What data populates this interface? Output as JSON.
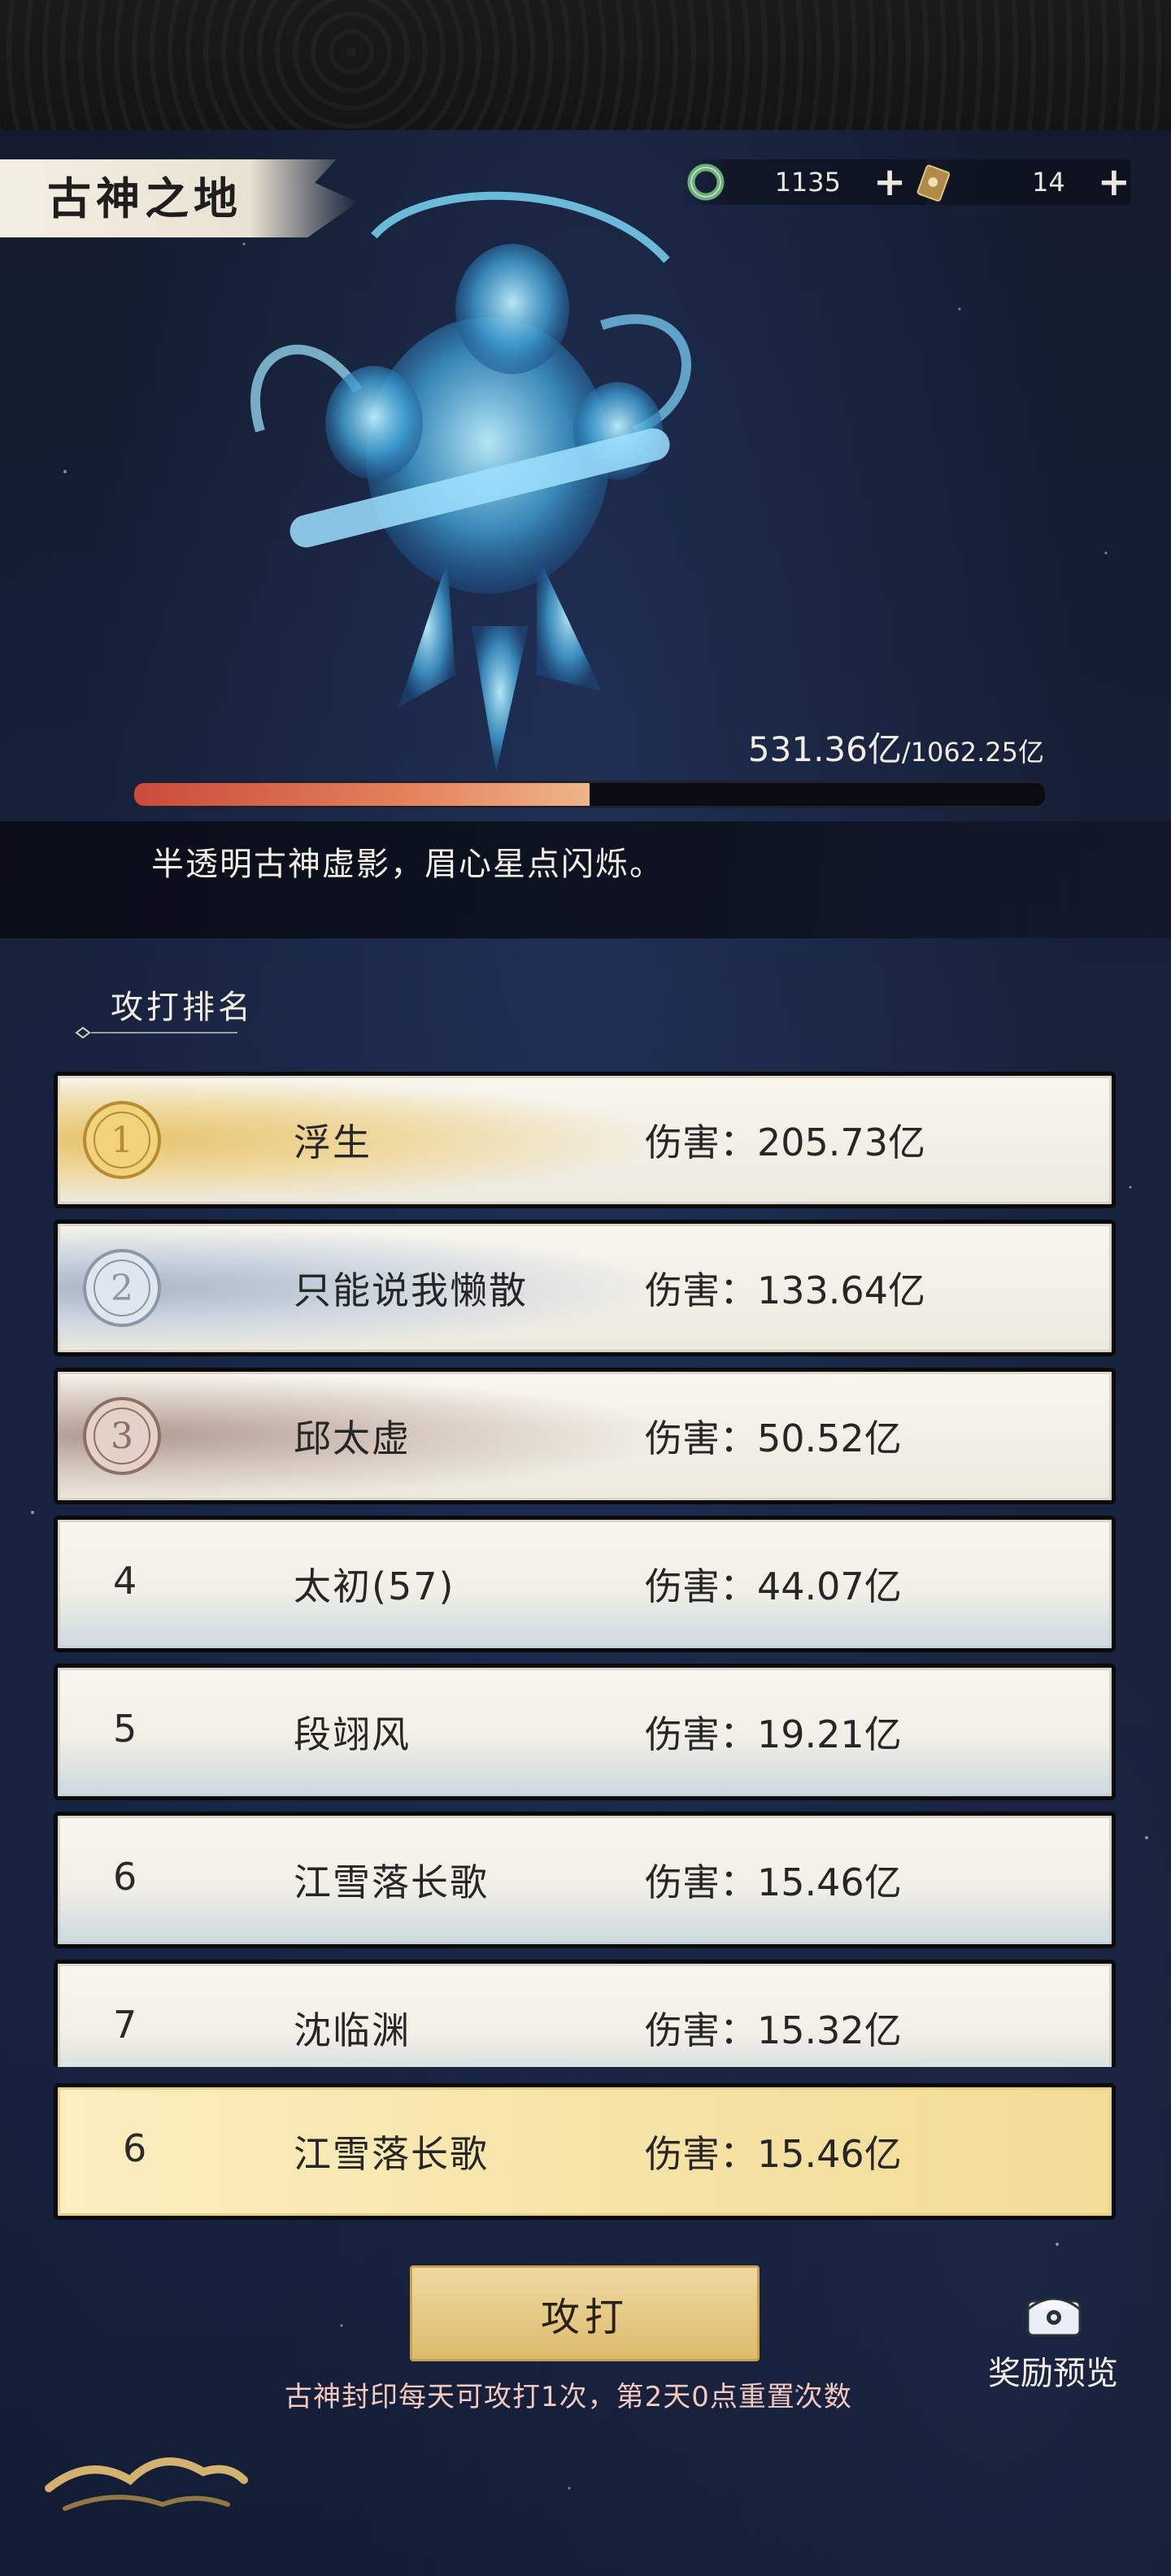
{
  "header": {
    "title": "古神之地",
    "currencies": [
      {
        "icon": "jade-ring-icon",
        "value": "1135",
        "add": "+"
      },
      {
        "icon": "card-token-icon",
        "value": "14",
        "add": "+"
      }
    ]
  },
  "boss": {
    "hp_current": "531.36亿",
    "hp_max": "/1062.25亿",
    "hp_fraction": 0.5,
    "description": "半透明古神虚影，眉心星点闪烁。"
  },
  "ranking": {
    "title": "攻打排名",
    "rows": [
      {
        "rank": "1",
        "name": "浮生",
        "damage": "伤害：205.73亿",
        "style": "gold"
      },
      {
        "rank": "2",
        "name": "只能说我懒散",
        "damage": "伤害：133.64亿",
        "style": "silver"
      },
      {
        "rank": "3",
        "name": "邱太虚",
        "damage": "伤害：50.52亿",
        "style": "bronze"
      },
      {
        "rank": "4",
        "name": "太初(57)",
        "damage": "伤害：44.07亿",
        "style": "plain"
      },
      {
        "rank": "5",
        "name": "段翊风",
        "damage": "伤害：19.21亿",
        "style": "plain"
      },
      {
        "rank": "6",
        "name": "江雪落长歌",
        "damage": "伤害：15.46亿",
        "style": "plain"
      },
      {
        "rank": "7",
        "name": "沈临渊",
        "damage": "伤害：15.32亿",
        "style": "plain"
      }
    ],
    "my_row": {
      "rank": "6",
      "name": "江雪落长歌",
      "damage": "伤害：15.46亿"
    }
  },
  "actions": {
    "attack_label": "攻打",
    "hint": "古神封印每天可攻打1次，第2天0点重置次数",
    "reward_label": "奖励预览"
  },
  "colors": {
    "hp_fill": "#e4825c",
    "gold_row": "#f6e4a8",
    "hint_text": "#f3c9bf"
  }
}
